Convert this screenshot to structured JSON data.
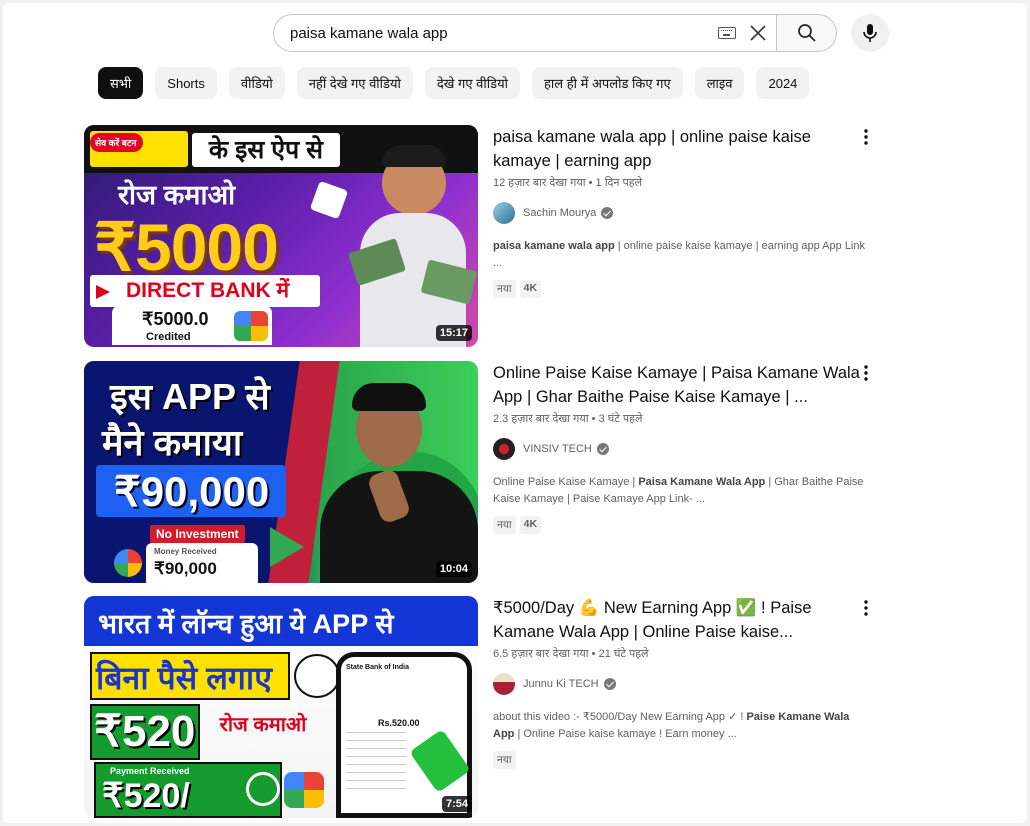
{
  "search": {
    "query": "paisa kamane wala app"
  },
  "chips": [
    "सभी",
    "Shorts",
    "वीडियो",
    "नहीं देखे गए वीडियो",
    "देखे गए वीडियो",
    "हाल ही में अपलोड किए गए",
    "लाइव",
    "2024"
  ],
  "results": [
    {
      "title": "paisa kamane wala app | online paise kaise kamaye | earning app",
      "views": "12 हज़ार बार देखा गया",
      "age": "1 दिन पहले",
      "channel": "Sachin Mourya",
      "desc_bold": "paisa kamane wala app",
      "desc_rest": " | online paise kaise kamaye | earning app App Link ...",
      "badges": [
        "नया",
        "4K"
      ],
      "duration": "15:17",
      "thumb": {
        "pin": "सेव करें बटन",
        "l1": "के इस ऐप से",
        "l2": "रोज कमाओ",
        "l3": "₹5000",
        "l4": "DIRECT BANK में",
        "l5": "₹5000.0",
        "l6": "Credited"
      }
    },
    {
      "title": "Online Paise Kaise Kamaye | Paisa Kamane Wala App | Ghar Baithe Paise Kaise Kamaye | ...",
      "views": "2.3 हज़ार बार देखा गया",
      "age": "3 घंटे पहले",
      "channel": "VINSIV TECH",
      "desc_pre": "Online Paise Kaise Kamaye | ",
      "desc_bold": "Paisa Kamane Wala App",
      "desc_rest": " | Ghar Baithe Paise Kaise Kamaye | Paise Kamaye App Link- ...",
      "badges": [
        "नया",
        "4K"
      ],
      "duration": "10:04",
      "thumb": {
        "l1": "इस APP से",
        "l2": "मैने कमाया",
        "l3": "₹90,000",
        "l4": "No Investment",
        "l5": "Money Received",
        "l6": "₹90,000"
      }
    },
    {
      "title": "₹5000/Day 💪 New Earning App ✅ ! Paise Kamane Wala App | Online Paise kaise...",
      "views": "6.5 हज़ार बार देखा गया",
      "age": "21 घंटे पहले",
      "channel": "Junnu Ki TECH",
      "desc_pre": "about this video :- ₹5000/Day New Earning App ✓ ! ",
      "desc_bold": "Paise Kamane Wala App",
      "desc_rest": " | Online Paise kaise kamaye ! Earn money ...",
      "badges": [
        "नया"
      ],
      "duration": "7:54",
      "thumb": {
        "l1": "भारत में लॉन्च हुआ ये APP से",
        "l2": "बिना पैसे लगाए",
        "l3": "₹520",
        "l4": "रोज कमाओ",
        "l5": "Payment Received",
        "l6": "₹520/",
        "l7": "State Bank of India",
        "l8": "Rs.520.00"
      }
    }
  ]
}
